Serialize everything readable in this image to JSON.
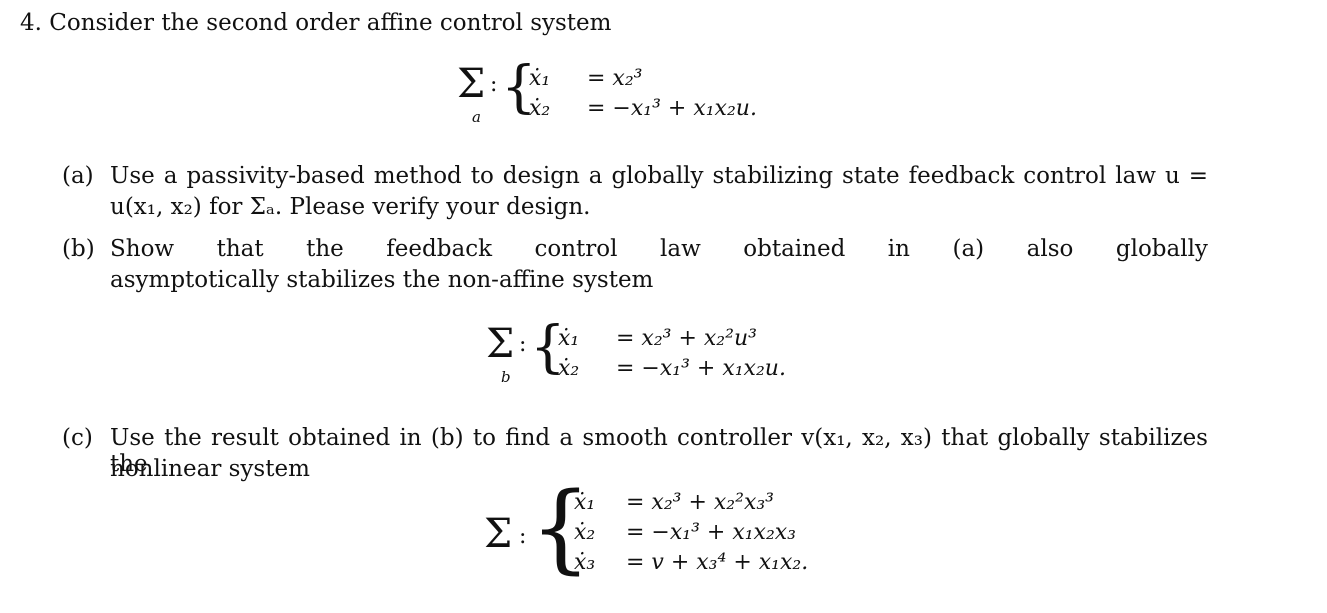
{
  "problem": {
    "heading": "4. Consider the second order affine control system",
    "system_a": {
      "sigma": "Σ",
      "label": "a",
      "rows": [
        {
          "lhs": "ẋ₁",
          "rhs": "= x₂³"
        },
        {
          "lhs": "ẋ₂",
          "rhs": "= −x₁³ + x₁x₂u."
        }
      ]
    },
    "part_a": {
      "marker": "(a)",
      "line1": "Use a passivity-based method to design a globally stabilizing state feedback control law u =",
      "line2": "u(x₁, x₂) for Σₐ.   Please verify your design."
    },
    "part_b": {
      "marker": "(b)",
      "line1_words": [
        "Show",
        "that",
        "the",
        "feedback",
        "control",
        "law",
        "obtained",
        "in",
        "(a)",
        "also",
        "globally"
      ],
      "line2": "asymptotically stabilizes the non-affine system"
    },
    "system_b": {
      "sigma": "Σ",
      "label": "b",
      "rows": [
        {
          "lhs": "ẋ₁",
          "rhs": "= x₂³ + x₂²u³"
        },
        {
          "lhs": "ẋ₂",
          "rhs": "= −x₁³ + x₁x₂u."
        }
      ]
    },
    "part_c": {
      "marker": "(c)",
      "line1": "Use the result obtained in (b) to find a smooth controller v(x₁, x₂, x₃) that globally stabilizes the",
      "line2": "nonlinear system"
    },
    "system_c": {
      "sigma": "Σ",
      "label": "",
      "rows": [
        {
          "lhs": "ẋ₁",
          "rhs": "= x₂³ + x₂²x₃³"
        },
        {
          "lhs": "ẋ₂",
          "rhs": "= −x₁³ + x₁x₂x₃"
        },
        {
          "lhs": "ẋ₃",
          "rhs": "= v + x₃⁴ + x₁x₂."
        }
      ]
    }
  }
}
